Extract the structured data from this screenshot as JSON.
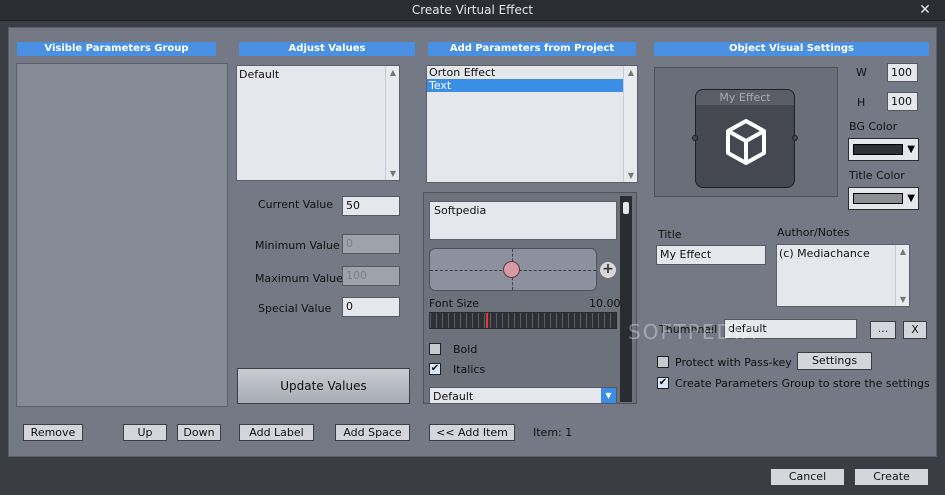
{
  "window": {
    "title": "Create Virtual Effect",
    "close_glyph": "✕"
  },
  "sections": {
    "visible_params": "Visible Parameters Group",
    "adjust_values": "Adjust Values",
    "add_params": "Add Parameters from Project",
    "object_visual": "Object Visual Settings"
  },
  "adjust": {
    "list_items": [
      "Default"
    ],
    "current_value_label": "Current Value",
    "current_value": "50",
    "min_value_label": "Minimum Value",
    "min_value": "0",
    "max_value_label": "Maximum Value",
    "max_value": "100",
    "special_value_label": "Special Value",
    "special_value": "0",
    "update_button": "Update Values"
  },
  "project_params": {
    "items": [
      "Orton Effect",
      "Text"
    ],
    "selected_index": 1
  },
  "editor": {
    "text_value": "Softpedia",
    "font_size_label": "Font Size",
    "font_size_value": "10.00",
    "bold_label": "Bold",
    "bold_checked": false,
    "italics_label": "Italics",
    "italics_checked": true,
    "font_select": "Default",
    "plus_glyph": "+"
  },
  "visual": {
    "preview_title": "My Effect",
    "w_label": "W",
    "w_value": "100",
    "h_label": "H",
    "h_value": "100",
    "bg_color_label": "BG Color",
    "bg_color": "#2f3136",
    "title_color_label": "Title Color",
    "title_color": "#8e8f92",
    "title_label": "Title",
    "title_value": "My Effect",
    "author_label": "Author/Notes",
    "author_value": "(c) Mediachance",
    "thumbnail_label": "Thumbnail",
    "thumbnail_value": "default",
    "browse_button": "...",
    "clear_button": "X",
    "protect_label": "Protect with Pass-key",
    "protect_checked": false,
    "settings_button": "Settings",
    "create_group_label": "Create Parameters Group to store the settings",
    "create_group_checked": true
  },
  "buttons": {
    "remove": "Remove",
    "up": "Up",
    "down": "Down",
    "add_label": "Add Label",
    "add_space": "Add Space",
    "add_item": "<< Add Item",
    "item_count": "Item: 1",
    "cancel": "Cancel",
    "create": "Create"
  },
  "watermark": "SOFTPEDIA",
  "colors": {
    "accent": "#4a90e2",
    "selection": "#3a8ee6"
  }
}
